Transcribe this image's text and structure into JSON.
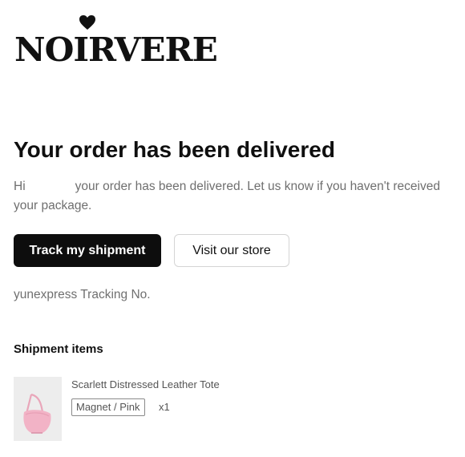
{
  "brand": {
    "logo_text": "NOIRVERE",
    "heart_icon": "heart-icon"
  },
  "email": {
    "heading": "Your order has been delivered",
    "greeting": "Hi",
    "message": "your order has been delivered. Let us know if you haven't received your package."
  },
  "actions": {
    "track_label": "Track my shipment",
    "store_label": "Visit our store"
  },
  "tracking": {
    "text": "yunexpress Tracking No."
  },
  "shipment": {
    "title": "Shipment items",
    "items": [
      {
        "name": "Scarlett Distressed Leather Tote",
        "variant": "Magnet / Pink",
        "quantity": "x1",
        "thumbnail": "pink-tote-bag-image"
      }
    ]
  },
  "colors": {
    "primary_button": "#0d0d0d",
    "text": "#111111",
    "muted_text": "#6f6f6f",
    "product_pink": "#f2b3c6"
  }
}
